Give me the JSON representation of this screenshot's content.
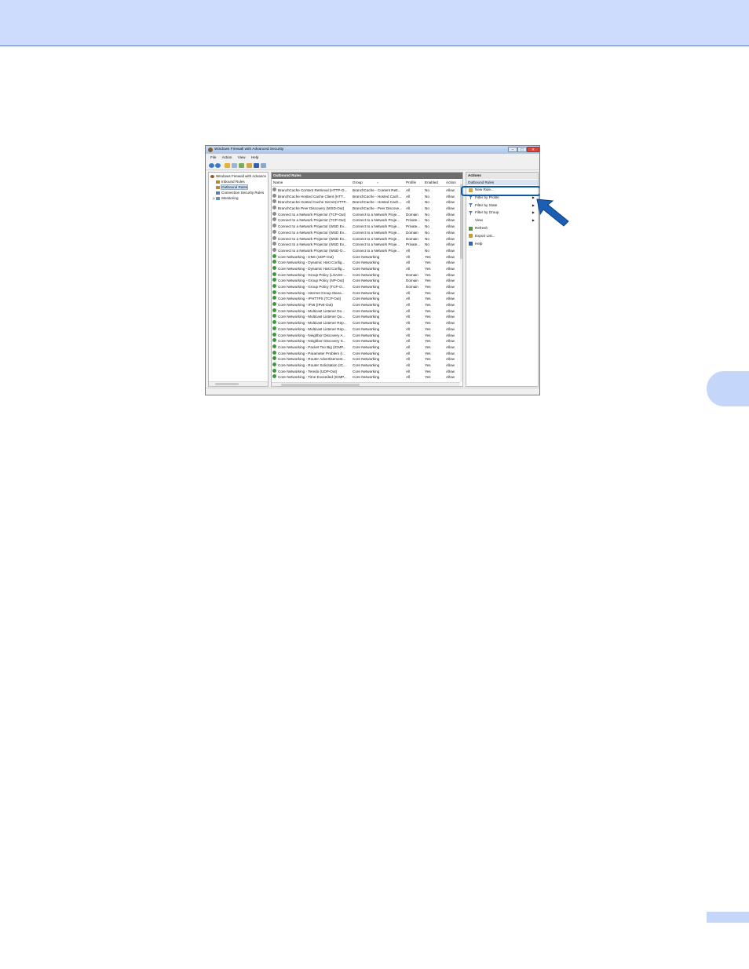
{
  "window": {
    "title": "Windows Firewall with Advanced Security",
    "controls": {
      "minimize": "–",
      "maximize": "□",
      "close": "✕"
    }
  },
  "menu": [
    "File",
    "Action",
    "View",
    "Help"
  ],
  "tree": {
    "root": "Windows Firewall with Advance",
    "items": [
      "Inbound Rules",
      "Outbound Rules",
      "Connection Security Rules",
      "Monitoring"
    ],
    "selected": "Outbound Rules"
  },
  "center": {
    "header": "Outbound Rules",
    "columns": [
      "Name",
      "Group",
      "Profile",
      "Enabled",
      "Action"
    ],
    "rows": [
      {
        "icon": "gray-circle-icon",
        "name": "BranchCache Content Retrieval (HTTP-O...",
        "group": "BranchCache - Content Retr...",
        "profile": "All",
        "enabled": "No",
        "action": "Allow"
      },
      {
        "icon": "gray-circle-icon",
        "name": "BranchCache Hosted Cache Client (HTT...",
        "group": "BranchCache - Hosted Cach...",
        "profile": "All",
        "enabled": "No",
        "action": "Allow"
      },
      {
        "icon": "gray-circle-icon",
        "name": "BranchCache Hosted Cache Server(HTTP...",
        "group": "BranchCache - Hosted Cach...",
        "profile": "All",
        "enabled": "No",
        "action": "Allow"
      },
      {
        "icon": "gray-circle-icon",
        "name": "BranchCache Peer Discovery (WSD-Out)",
        "group": "BranchCache - Peer Discove...",
        "profile": "All",
        "enabled": "No",
        "action": "Allow"
      },
      {
        "icon": "gray-circle-icon",
        "name": "Connect to a Network Projector (TCP-Out)",
        "group": "Connect to a Network Proje...",
        "profile": "Domain",
        "enabled": "No",
        "action": "Allow"
      },
      {
        "icon": "gray-circle-icon",
        "name": "Connect to a Network Projector (TCP-Out)",
        "group": "Connect to a Network Proje...",
        "profile": "Private...",
        "enabled": "No",
        "action": "Allow"
      },
      {
        "icon": "gray-circle-icon",
        "name": "Connect to a Network Projector (WSD Ev...",
        "group": "Connect to a Network Proje...",
        "profile": "Private...",
        "enabled": "No",
        "action": "Allow"
      },
      {
        "icon": "gray-circle-icon",
        "name": "Connect to a Network Projector (WSD Ev...",
        "group": "Connect to a Network Proje...",
        "profile": "Domain",
        "enabled": "No",
        "action": "Allow"
      },
      {
        "icon": "gray-circle-icon",
        "name": "Connect to a Network Projector (WSD Ev...",
        "group": "Connect to a Network Proje...",
        "profile": "Domain",
        "enabled": "No",
        "action": "Allow"
      },
      {
        "icon": "gray-circle-icon",
        "name": "Connect to a Network Projector (WSD Ev...",
        "group": "Connect to a Network Proje...",
        "profile": "Private...",
        "enabled": "No",
        "action": "Allow"
      },
      {
        "icon": "gray-circle-icon",
        "name": "Connect to a Network Projector (WSD-O...",
        "group": "Connect to a Network Proje...",
        "profile": "All",
        "enabled": "No",
        "action": "Allow"
      },
      {
        "icon": "green-check-icon",
        "name": "Core Networking - DNS (UDP-Out)",
        "group": "Core Networking",
        "profile": "All",
        "enabled": "Yes",
        "action": "Allow"
      },
      {
        "icon": "green-check-icon",
        "name": "Core Networking - Dynamic Host Config...",
        "group": "Core Networking",
        "profile": "All",
        "enabled": "Yes",
        "action": "Allow"
      },
      {
        "icon": "green-check-icon",
        "name": "Core Networking - Dynamic Host Config...",
        "group": "Core Networking",
        "profile": "All",
        "enabled": "Yes",
        "action": "Allow"
      },
      {
        "icon": "green-check-icon",
        "name": "Core Networking - Group Policy (LSASS-...",
        "group": "Core Networking",
        "profile": "Domain",
        "enabled": "Yes",
        "action": "Allow"
      },
      {
        "icon": "green-check-icon",
        "name": "Core Networking - Group Policy (NP-Out)",
        "group": "Core Networking",
        "profile": "Domain",
        "enabled": "Yes",
        "action": "Allow"
      },
      {
        "icon": "green-check-icon",
        "name": "Core Networking - Group Policy (TCP-O...",
        "group": "Core Networking",
        "profile": "Domain",
        "enabled": "Yes",
        "action": "Allow"
      },
      {
        "icon": "green-check-icon",
        "name": "Core Networking - Internet Group Mana...",
        "group": "Core Networking",
        "profile": "All",
        "enabled": "Yes",
        "action": "Allow"
      },
      {
        "icon": "green-check-icon",
        "name": "Core Networking - IPHTTPS (TCP-Out)",
        "group": "Core Networking",
        "profile": "All",
        "enabled": "Yes",
        "action": "Allow"
      },
      {
        "icon": "green-check-icon",
        "name": "Core Networking - IPv6 (IPv6-Out)",
        "group": "Core Networking",
        "profile": "All",
        "enabled": "Yes",
        "action": "Allow"
      },
      {
        "icon": "green-check-icon",
        "name": "Core Networking - Multicast Listener Do...",
        "group": "Core Networking",
        "profile": "All",
        "enabled": "Yes",
        "action": "Allow"
      },
      {
        "icon": "green-check-icon",
        "name": "Core Networking - Multicast Listener Qu...",
        "group": "Core Networking",
        "profile": "All",
        "enabled": "Yes",
        "action": "Allow"
      },
      {
        "icon": "green-check-icon",
        "name": "Core Networking - Multicast Listener Rep...",
        "group": "Core Networking",
        "profile": "All",
        "enabled": "Yes",
        "action": "Allow"
      },
      {
        "icon": "green-check-icon",
        "name": "Core Networking - Multicast Listener Rep...",
        "group": "Core Networking",
        "profile": "All",
        "enabled": "Yes",
        "action": "Allow"
      },
      {
        "icon": "green-check-icon",
        "name": "Core Networking - Neighbor Discovery A...",
        "group": "Core Networking",
        "profile": "All",
        "enabled": "Yes",
        "action": "Allow"
      },
      {
        "icon": "green-check-icon",
        "name": "Core Networking - Neighbor Discovery S...",
        "group": "Core Networking",
        "profile": "All",
        "enabled": "Yes",
        "action": "Allow"
      },
      {
        "icon": "green-check-icon",
        "name": "Core Networking - Packet Too Big (ICMP...",
        "group": "Core Networking",
        "profile": "All",
        "enabled": "Yes",
        "action": "Allow"
      },
      {
        "icon": "green-check-icon",
        "name": "Core Networking - Parameter Problem (I...",
        "group": "Core Networking",
        "profile": "All",
        "enabled": "Yes",
        "action": "Allow"
      },
      {
        "icon": "green-check-icon",
        "name": "Core Networking - Router Advertisement...",
        "group": "Core Networking",
        "profile": "All",
        "enabled": "Yes",
        "action": "Allow"
      },
      {
        "icon": "green-check-icon",
        "name": "Core Networking - Router Solicitation (IC...",
        "group": "Core Networking",
        "profile": "All",
        "enabled": "Yes",
        "action": "Allow"
      },
      {
        "icon": "green-check-icon",
        "name": "Core Networking - Teredo (UDP-Out)",
        "group": "Core Networking",
        "profile": "All",
        "enabled": "Yes",
        "action": "Allow"
      },
      {
        "icon": "green-check-icon",
        "name": "Core Networking - Time Exceeded (ICMP...",
        "group": "Core Networking",
        "profile": "All",
        "enabled": "Yes",
        "action": "Allow"
      }
    ]
  },
  "actions": {
    "header": "Actions",
    "section": "Outbound Rules",
    "items": [
      {
        "label": "New Rule...",
        "icon": "new-rule-icon",
        "submenu": false
      },
      {
        "label": "Filter by Profile",
        "icon": "filter-icon",
        "submenu": true
      },
      {
        "label": "Filter by State",
        "icon": "filter-icon",
        "submenu": true
      },
      {
        "label": "Filter by Group",
        "icon": "filter-icon",
        "submenu": true
      },
      {
        "label": "View",
        "icon": "",
        "submenu": true
      },
      {
        "label": "Refresh",
        "icon": "refresh-icon",
        "submenu": false
      },
      {
        "label": "Export List...",
        "icon": "export-icon",
        "submenu": false
      },
      {
        "label": "Help",
        "icon": "help-icon",
        "submenu": false
      }
    ]
  },
  "colors": {
    "header_band": "#cddcfd",
    "chapter_tab": "#c5d6fb",
    "pointer_arrow": "#1a5fb4",
    "highlight": "#0c5aa6"
  }
}
